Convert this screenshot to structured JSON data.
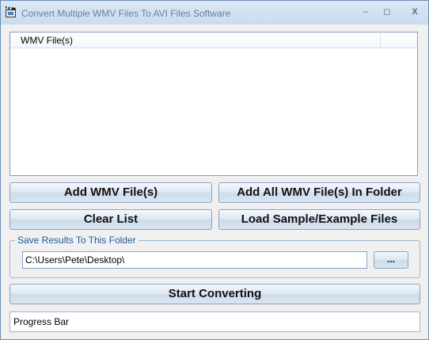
{
  "window": {
    "title": "Convert Multiple WMV Files To AVI Files Software",
    "minimize_glyph": "–",
    "maximize_glyph": "◻",
    "close_glyph": "X"
  },
  "file_list": {
    "column_header": "WMV File(s)",
    "items": []
  },
  "buttons": {
    "add_files": "Add WMV File(s)",
    "add_folder": "Add All WMV File(s) In Folder",
    "clear_list": "Clear List",
    "load_samples": "Load Sample/Example Files",
    "start_converting": "Start Converting"
  },
  "output_folder": {
    "group_label": "Save Results To This Folder",
    "path": "C:\\Users\\Pete\\Desktop\\",
    "browse_label": "..."
  },
  "progress": {
    "label": "Progress Bar"
  },
  "colors": {
    "accent": "#1d5a9c",
    "button_border": "#8aa3c2"
  },
  "icons": {
    "app": "film-clapper-icon"
  }
}
